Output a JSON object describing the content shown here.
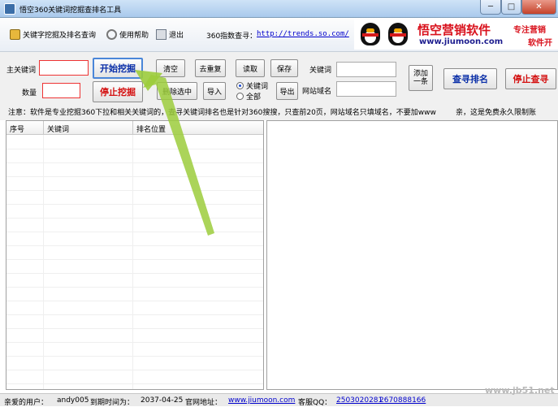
{
  "window": {
    "title": "悟空360关键词挖掘查排名工具",
    "minimize": "─",
    "maximize": "□",
    "close": "✕"
  },
  "toolbar": {
    "dig_rank": "关键字挖掘及排名查询",
    "help": "使用帮助",
    "exit": "退出",
    "trend_label": "360指数查寻：",
    "trend_url": "http://trends.so.com/"
  },
  "ad": {
    "title": "悟空营销软件",
    "url": "www.jiumoon.com",
    "slogan1": "专注营销",
    "slogan2": "软件开"
  },
  "form": {
    "main_keyword_label": "主关键词",
    "main_keyword_value": "",
    "count_label": "数量",
    "count_value": "",
    "start_dig": "开始挖掘",
    "stop_dig": "停止挖掘",
    "clear": "清空",
    "dedupe": "去重复",
    "delete_selected": "删除选中",
    "read": "读取",
    "import": "导入",
    "save": "保存",
    "export": "导出",
    "radio_keyword": "关键词",
    "radio_all": "全部",
    "keyword_label": "关键词",
    "keyword_value": "",
    "domain_label": "网站域名",
    "domain_value": "",
    "add_one_line1": "添加",
    "add_one_line2": "一条",
    "query_rank": "查寻排名",
    "stop_query": "停止查寻"
  },
  "notice": "注意：软件是专业挖掘360下拉和相关关键词的，查寻关键词排名也是针对360搜搜，只查前20页，网站域名只填域名，不要加www",
  "notice_right": "亲，这是免费永久限制账",
  "table": {
    "columns": [
      "序号",
      "关键词",
      "排名位置"
    ]
  },
  "status": {
    "user_label": "亲爱的用户：",
    "user": "andy005",
    "expire_label": "到期时间为：",
    "expire": "2037-04-25",
    "site_label": "官网地址：",
    "site": "www.jiumoon.com",
    "qq_label": "客服QQ：",
    "qq1": "2503020281",
    "qq2": "2670888166"
  },
  "watermark": "www.jb51.net",
  "colors": {
    "accent": "#4a86d8",
    "danger": "#d41010",
    "arrow": "#9ccc3c"
  }
}
